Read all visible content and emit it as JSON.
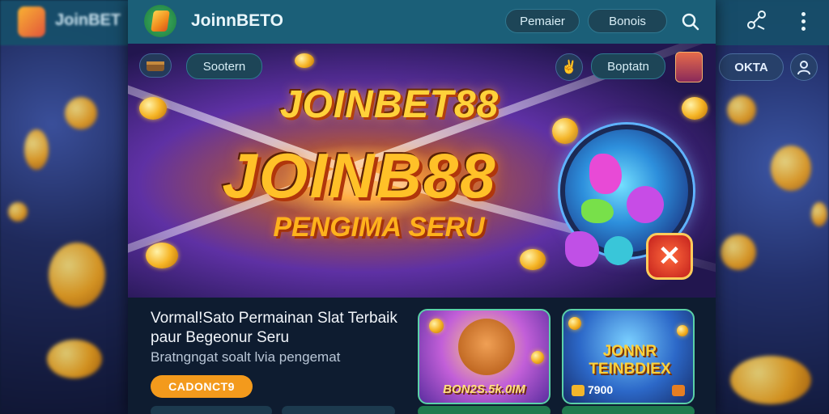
{
  "app": {
    "brand": "JoinnBETO",
    "background_brand": "JoinBET"
  },
  "topbar": {
    "nav_primary": "Pemaier",
    "nav_secondary": "Bonois",
    "search_icon": "search-icon"
  },
  "hero": {
    "left_pill": "Sootern",
    "right_pill": "Boptatn",
    "title_top": "JOINBET88",
    "title_main": "JOINB88",
    "tagline": "PENGIMA SERU"
  },
  "right_panel": {
    "okta_label": "OKTA"
  },
  "promo": {
    "title": "Vormal!Sato Permainan Slat Terbaik paur Begeonur Seru",
    "subtitle": "Bratngngat soalt lvia pengemat",
    "cta_label": "CADONCT9"
  },
  "cards": [
    {
      "label": "BON2S.5k.0IM"
    },
    {
      "title": "JONNR TEINBDIEX",
      "value": "7900"
    }
  ],
  "colors": {
    "topbar": "#1b5f78",
    "accent_orange": "#f39a1c",
    "card_border": "#5ad1a8",
    "gold": "#ffc128"
  }
}
